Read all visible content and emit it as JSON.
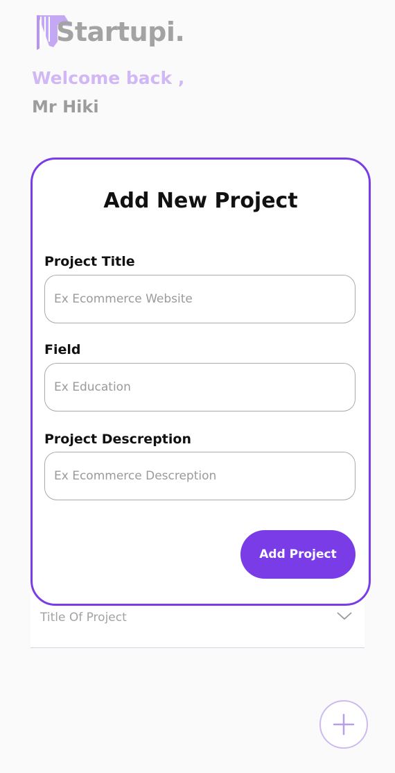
{
  "app": {
    "logo_text": "Startupi.",
    "brand_color": "#7a3ce6",
    "logo_icon": "startupi-logo-icon"
  },
  "greeting": {
    "welcome": "Welcome back ,",
    "username": "Mr Hiki"
  },
  "modal": {
    "title": "Add New Project",
    "fields": [
      {
        "label": "Project Title",
        "placeholder": "Ex Ecommerce Website",
        "value": ""
      },
      {
        "label": "Field",
        "placeholder": "Ex Education",
        "value": ""
      },
      {
        "label": "Project Descreption",
        "placeholder": "Ex Ecommerce Descreption",
        "value": ""
      }
    ],
    "submit_label": "Add Project"
  },
  "project_list": {
    "items": [
      {
        "title": "Title Of Project",
        "icon": "chevron-down-icon"
      }
    ]
  },
  "fab": {
    "icon": "plus-icon"
  }
}
